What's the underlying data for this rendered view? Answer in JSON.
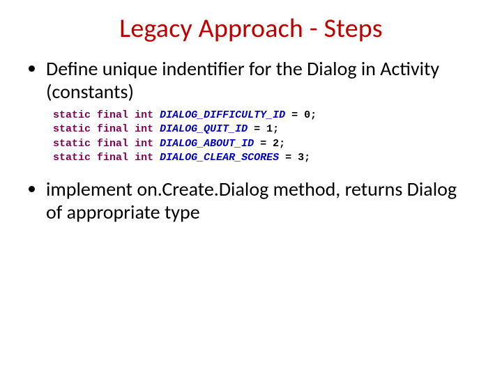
{
  "title": "Legacy Approach - Steps",
  "bullets": {
    "b1": "Define unique indentifier for the Dialog in Activity (constants)",
    "b2": "implement on.Create.Dialog method, returns Dialog of appropriate type"
  },
  "code": {
    "kw_static": "static",
    "kw_final": "final",
    "kw_int": "int",
    "lines": [
      {
        "name": "DIALOG_DIFFICULTY_ID",
        "val": "0"
      },
      {
        "name": "DIALOG_QUIT_ID",
        "val": "1"
      },
      {
        "name": "DIALOG_ABOUT_ID",
        "val": "2"
      },
      {
        "name": "DIALOG_CLEAR_SCORES",
        "val": "3"
      }
    ]
  }
}
